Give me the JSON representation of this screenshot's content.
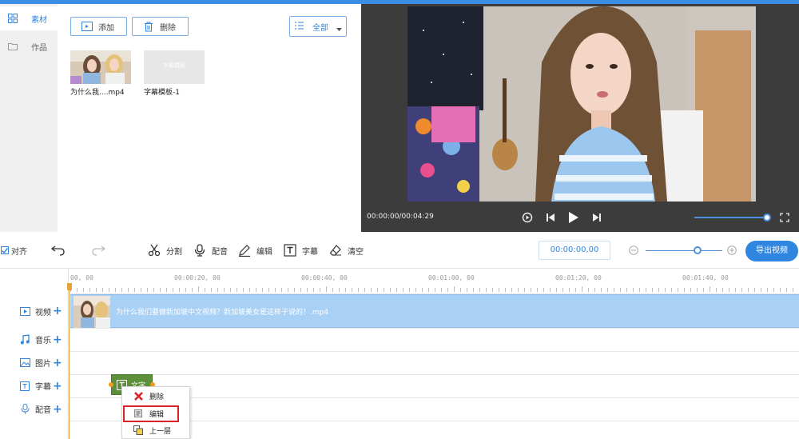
{
  "sidebar": {
    "items": [
      {
        "label": "素材",
        "icon": "grid-icon",
        "active": true
      },
      {
        "label": "作品",
        "icon": "folder-icon",
        "active": false
      }
    ]
  },
  "library": {
    "add_label": "添加",
    "delete_label": "删除",
    "filter_label": "全部",
    "items": [
      {
        "label": "为什么我....mp4"
      },
      {
        "label": "字幕模板-1",
        "overlay_text": "字幕模板"
      }
    ]
  },
  "player": {
    "time_display": "00:00:00/00:04:29"
  },
  "toolbar": {
    "snap_label": "对齐",
    "split_label": "分割",
    "dub_label": "配音",
    "edit_label": "编辑",
    "subtitle_label": "字幕",
    "clear_label": "清空",
    "timecode": "00:00:00,00",
    "export_label": "导出视频"
  },
  "timeline": {
    "ruler_labels": [
      "00, 00",
      "00:00:20, 00",
      "00:00:40, 00",
      "00:01:00, 00",
      "00:01:20, 00",
      "00:01:40, 00"
    ],
    "tracks": [
      {
        "label": "视频",
        "icon": "video-icon"
      },
      {
        "label": "音乐",
        "icon": "music-icon"
      },
      {
        "label": "图片",
        "icon": "image-icon"
      },
      {
        "label": "字幕",
        "icon": "text-icon"
      },
      {
        "label": "配音",
        "icon": "mic-icon"
      }
    ],
    "video_clip_title": "为什么我们要做新加坡中文视频？新加坡美女是这样子说的！.mp4",
    "subtitle_clip_label": "文字"
  },
  "context_menu": {
    "items": [
      "删除",
      "编辑",
      "上一层"
    ]
  },
  "colors": {
    "accent": "#2f86e0",
    "highlight_border": "#d9232a",
    "video_clip": "#a9d0f5",
    "subtitle_clip": "#5e8f3a"
  }
}
